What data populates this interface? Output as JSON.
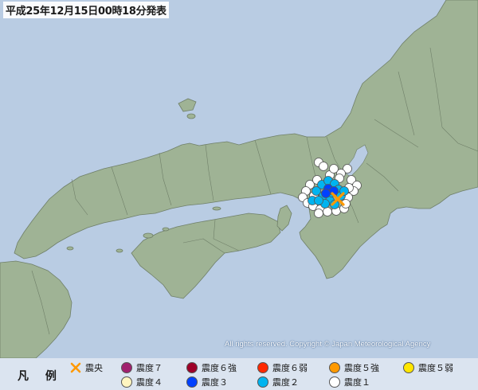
{
  "header": {
    "title": "平成25年12月15日00時18分発表"
  },
  "map": {
    "copyright": "All rights reserved. Copyright © Japan Meteorological Agency",
    "colors": {
      "sea": "#b9cce3",
      "land": "#9fb395",
      "border": "#6f7f68",
      "lake": "#b9cce3"
    },
    "epicenter_icon": "x-mark-icon"
  },
  "legend": {
    "heading": "凡 例",
    "items": [
      {
        "label": "震央",
        "kind": "epicenter",
        "color": "#ff9900"
      },
      {
        "label": "震度７",
        "kind": "circle",
        "color": "#a0206e"
      },
      {
        "label": "震度６強",
        "kind": "circle",
        "color": "#9e0028"
      },
      {
        "label": "震度６弱",
        "kind": "circle",
        "color": "#ff2800"
      },
      {
        "label": "震度５強",
        "kind": "circle",
        "color": "#ff9900"
      },
      {
        "label": "震度５弱",
        "kind": "circle",
        "color": "#ffe600"
      },
      {
        "label": "震度４",
        "kind": "circle",
        "color": "#fff5c0"
      },
      {
        "label": "震度３",
        "kind": "circle",
        "color": "#0041ff"
      },
      {
        "label": "震度２",
        "kind": "circle",
        "color": "#00b4f0"
      },
      {
        "label": "震度１",
        "kind": "circle",
        "color": "#ffffff"
      }
    ]
  }
}
